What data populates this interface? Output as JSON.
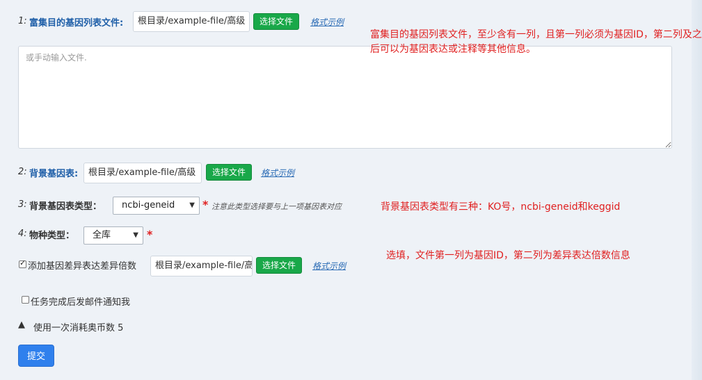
{
  "step1": {
    "num": "1:",
    "label": "富集目的基因列表文件:",
    "path_value": "根目录/example-file/高级",
    "choose_label": "选择文件",
    "example_label": "格式示例",
    "textarea_placeholder": "或手动输入文件.",
    "hint": "富集目的基因列表文件，至少含有一列，且第一列必须为基因ID，第二列及之后可以为基因表达或注释等其他信息。"
  },
  "step2": {
    "num": "2:",
    "label": "背景基因表:",
    "path_value": "根目录/example-file/高级",
    "choose_label": "选择文件",
    "example_label": "格式示例"
  },
  "step3": {
    "num": "3:",
    "label": "背景基因表类型：",
    "selected": "ncbi-geneid",
    "note": "注意此类型选择要与上一项基因表对应",
    "hint": "背景基因表类型有三种：KO号，ncbi-geneid和keggid"
  },
  "step4": {
    "num": "4:",
    "label": "物种类型：",
    "selected": "全库"
  },
  "diff_fold": {
    "checked": true,
    "label": "添加基因差异表达差异倍数",
    "path_value": "根目录/example-file/高级",
    "choose_label": "选择文件",
    "example_label": "格式示例",
    "hint": "选填，文件第一列为基因ID，第二列为差异表达倍数信息"
  },
  "email_notify": {
    "checked": false,
    "label": "任务完成后发邮件通知我"
  },
  "cost": {
    "text": "使用一次消耗奥币数 5"
  },
  "submit_label": "提交",
  "required_mark": "*",
  "colors": {
    "accent_green": "#19a849",
    "hint_red": "#e02020",
    "label_blue": "#1f5fa8",
    "submit_blue": "#2f80ed"
  }
}
